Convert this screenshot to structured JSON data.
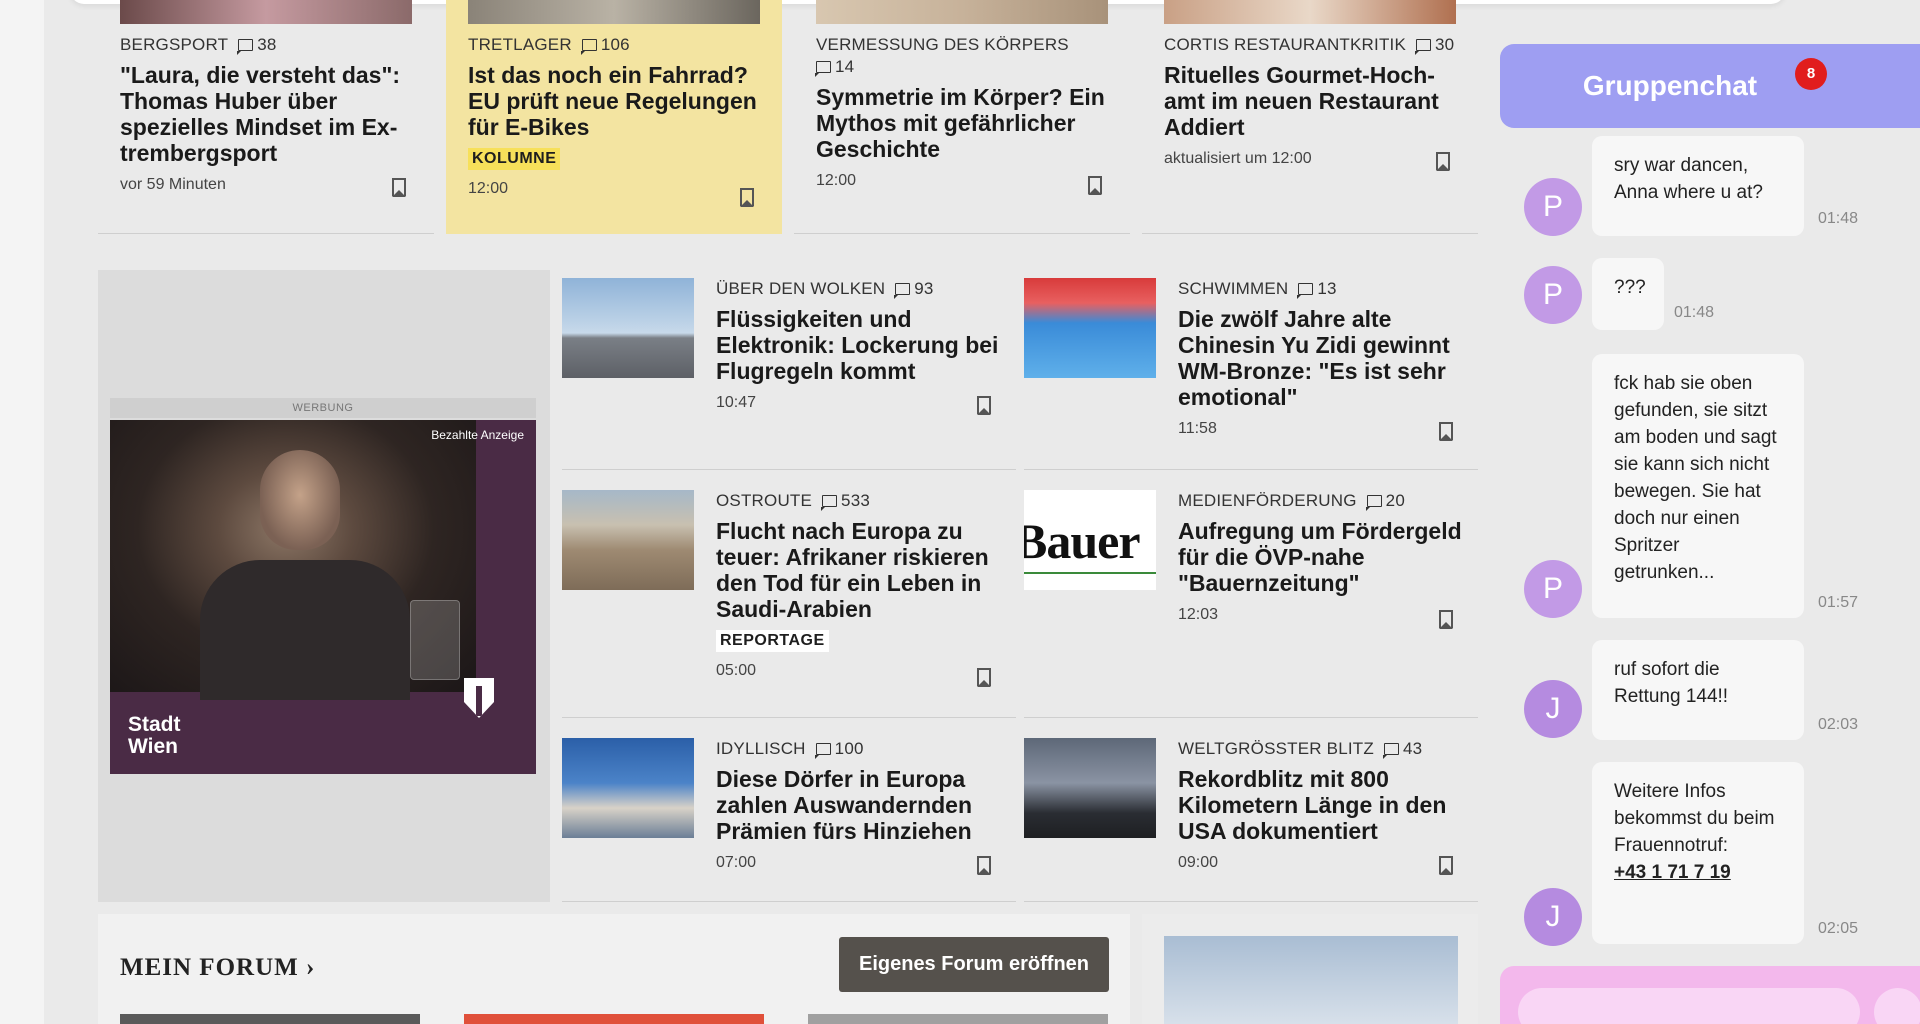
{
  "top_cards": [
    {
      "kicker": "BERGSPORT",
      "comments": "38",
      "headline": "\"Laura, die versteht das\": Thomas Huber über spezielles Mindset im Ex­trembergsport",
      "meta": "vor 59 Minuten",
      "tag": ""
    },
    {
      "kicker": "TRETLAGER",
      "comments": "106",
      "headline": "Ist das noch ein Fahrrad? EU prüft neue Regelungen für E-Bikes",
      "meta": "12:00",
      "tag": "KOLUMNE"
    },
    {
      "kicker": "VERMESSUNG DES KÖRPERS",
      "comments": "14",
      "headline": "Symmetrie im Körper? Ein Mythos mit gefährlicher Geschichte",
      "meta": "12:00",
      "tag": ""
    },
    {
      "kicker": "CORTIS RESTAURANTKRITIK",
      "comments": "30",
      "headline": "Rituelles Gourmet-Hoch­amt im neuen Restaurant Addiert",
      "meta": "aktualisiert um 12:00",
      "tag": ""
    }
  ],
  "ad": {
    "label": "WERBUNG",
    "caption": "Bezahlte Anzeige",
    "brand_line1": "Stadt",
    "brand_line2": "Wien"
  },
  "grid_items": [
    {
      "kicker": "ÜBER DEN WOLKEN",
      "comments": "93",
      "headline": "Flüssigkeiten und Elektronik: Lockerung bei Flugregeln kommt",
      "meta": "10:47",
      "tag": ""
    },
    {
      "kicker": "SCHWIMMEN",
      "comments": "13",
      "headline": "Die zwölf Jahre alte Chinesin Yu Zidi gewinnt WM-Bronze: \"Es ist sehr emotional\"",
      "meta": "11:58",
      "tag": ""
    },
    {
      "kicker": "OSTROUTE",
      "comments": "533",
      "headline": "Flucht nach Europa zu teuer: Afrikaner riskieren den Tod für ein Leben in Saudi-Arabien",
      "meta": "05:00",
      "tag": "REPORTAGE"
    },
    {
      "kicker": "MEDIENFÖRDERUNG",
      "comments": "20",
      "headline": "Aufregung um Fördergeld für die ÖVP-nahe \"Bauernzeitung\"",
      "meta": "12:03",
      "tag": ""
    },
    {
      "kicker": "IDYLLISCH",
      "comments": "100",
      "headline": "Diese Dörfer in Europa zahlen Auswandernden Prämien fürs Hinziehen",
      "meta": "07:00",
      "tag": ""
    },
    {
      "kicker": "WELTGRÖSSTER BLITZ",
      "comments": "43",
      "headline": "Rekordblitz mit 800 Kilometern Länge in den USA dokumentiert",
      "meta": "09:00",
      "tag": ""
    }
  ],
  "forum": {
    "title": "MEIN FORUM ›",
    "button_label": "Eigenes Forum eröffnen"
  },
  "chat": {
    "title": "Gruppenchat",
    "badge": "8",
    "messages": [
      {
        "avatar": "P",
        "text": "sry war dancen, Anna where u at?",
        "time": "01:48"
      },
      {
        "avatar": "P",
        "text": "???",
        "time": "01:48"
      },
      {
        "avatar": "P",
        "text": "fck hab sie oben gefunden, sie sitzt am boden und sagt sie kann sich nicht bewegen. Sie hat doch nur einen Spritzer getrunken...",
        "time": "01:57"
      },
      {
        "avatar": "J",
        "text": "ruf sofort die Rettung 144!!",
        "time": "02:03"
      },
      {
        "avatar": "J",
        "text": "Weitere Infos bekommst du beim Frauennotruf:",
        "link": "+43 1 71 7 19",
        "time": "02:05"
      }
    ]
  },
  "colors": {
    "chat_header": "#9e9ef2",
    "chat_avatar": "#c29ae6",
    "highlight_card": "#f3e4a1",
    "kolumne_tag": "#f7e05a",
    "badge": "#e11d1d",
    "forum_button": "#55514c",
    "chat_input_bar": "#f3b8ec"
  }
}
